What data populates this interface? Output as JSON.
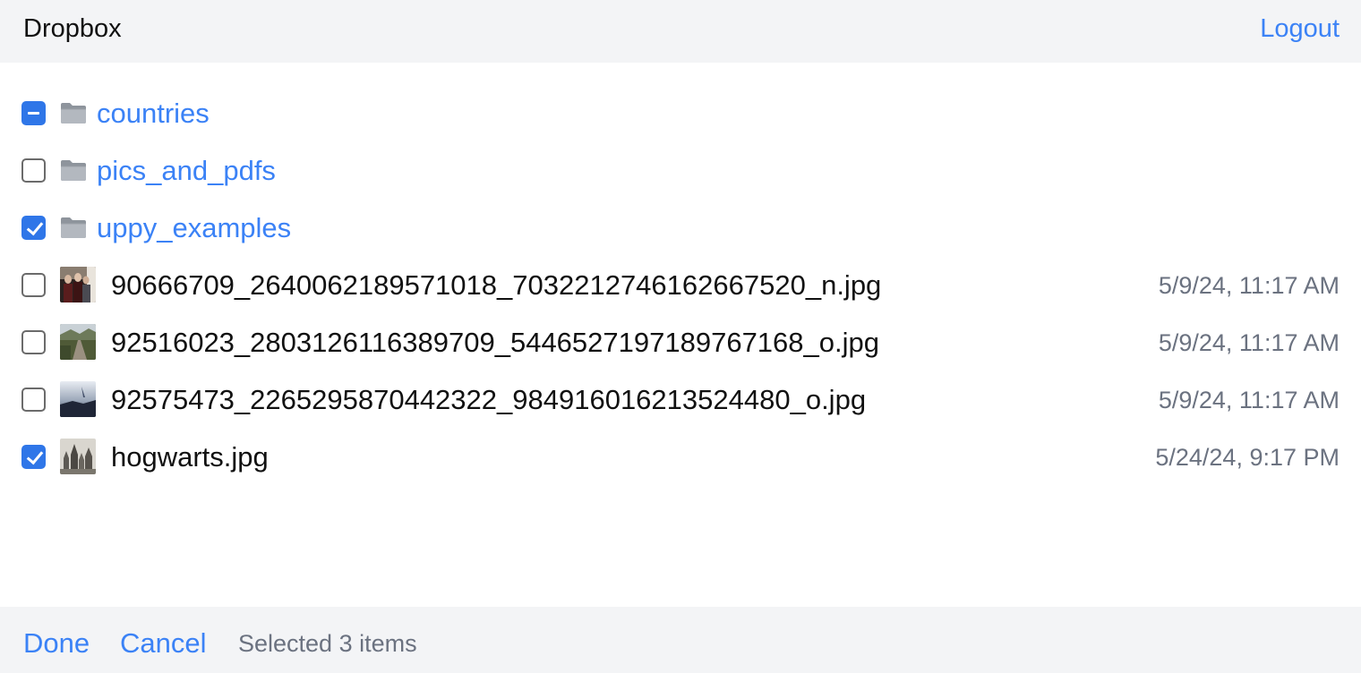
{
  "header": {
    "title": "Dropbox",
    "logout_label": "Logout"
  },
  "folders": [
    {
      "name": "countries",
      "state": "indeterminate",
      "icon": "folder-icon"
    },
    {
      "name": "pics_and_pdfs",
      "state": "unchecked",
      "icon": "folder-icon"
    },
    {
      "name": "uppy_examples",
      "state": "checked",
      "icon": "folder-icon"
    }
  ],
  "files": [
    {
      "name": "90666709_2640062189571018_7032212746162667520_n.jpg",
      "modified": "5/9/24, 11:17 AM",
      "checked": false,
      "thumbnail": "people-photo-thumbnail"
    },
    {
      "name": "92516023_2803126116389709_5446527197189767168_o.jpg",
      "modified": "5/9/24, 11:17 AM",
      "checked": false,
      "thumbnail": "landscape-road-thumbnail"
    },
    {
      "name": "92575473_2265295870442322_984916016213524480_o.jpg",
      "modified": "5/9/24, 11:17 AM",
      "checked": false,
      "thumbnail": "sky-water-thumbnail"
    },
    {
      "name": "hogwarts.jpg",
      "modified": "5/24/24, 9:17 PM",
      "checked": true,
      "thumbnail": "castle-thumbnail"
    }
  ],
  "footer": {
    "done_label": "Done",
    "cancel_label": "Cancel",
    "selected_text": "Selected 3 items"
  },
  "colors": {
    "accent": "#3b82f6",
    "checkbox_checked": "#2f76e8",
    "bar_background": "#f3f4f6",
    "muted_text": "#6b7280"
  }
}
